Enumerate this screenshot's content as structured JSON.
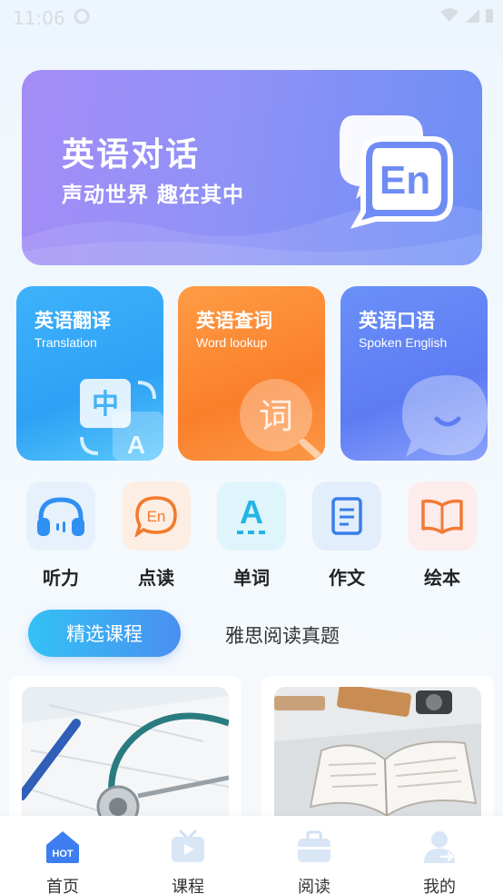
{
  "status_bar": {
    "time": "11:06"
  },
  "hero": {
    "title": "英语对话",
    "subtitle": "声动世界 趣在其中",
    "badge": "En"
  },
  "feature_cards": [
    {
      "title": "英语翻译",
      "subtitle": "Translation",
      "glyph_a": "中",
      "glyph_b": "A"
    },
    {
      "title": "英语查词",
      "subtitle": "Word lookup",
      "glyph": "词"
    },
    {
      "title": "英语口语",
      "subtitle": "Spoken English"
    }
  ],
  "quick_actions": [
    {
      "label": "听力",
      "icon": "headphones-icon"
    },
    {
      "label": "点读",
      "icon": "en-bubble-icon",
      "glyph": "En"
    },
    {
      "label": "单词",
      "icon": "letter-a-icon",
      "glyph": "A"
    },
    {
      "label": "作文",
      "icon": "document-icon"
    },
    {
      "label": "绘本",
      "icon": "open-book-icon"
    }
  ],
  "tabs": [
    {
      "label": "精选课程",
      "active": true
    },
    {
      "label": "雅思阅读真题",
      "active": false
    }
  ],
  "bottom_nav": [
    {
      "label": "首页",
      "icon": "home-hot-icon",
      "badge": "HOT",
      "active": true
    },
    {
      "label": "课程",
      "icon": "tv-play-icon"
    },
    {
      "label": "阅读",
      "icon": "briefcase-icon"
    },
    {
      "label": "我的",
      "icon": "user-icon"
    }
  ],
  "colors": {
    "accent_blue": "#4a8ff0",
    "hero_start": "#a58cf7",
    "hero_end": "#6c8ef5",
    "orange": "#fa7f2b",
    "nav_active": "#3f7ef0"
  }
}
